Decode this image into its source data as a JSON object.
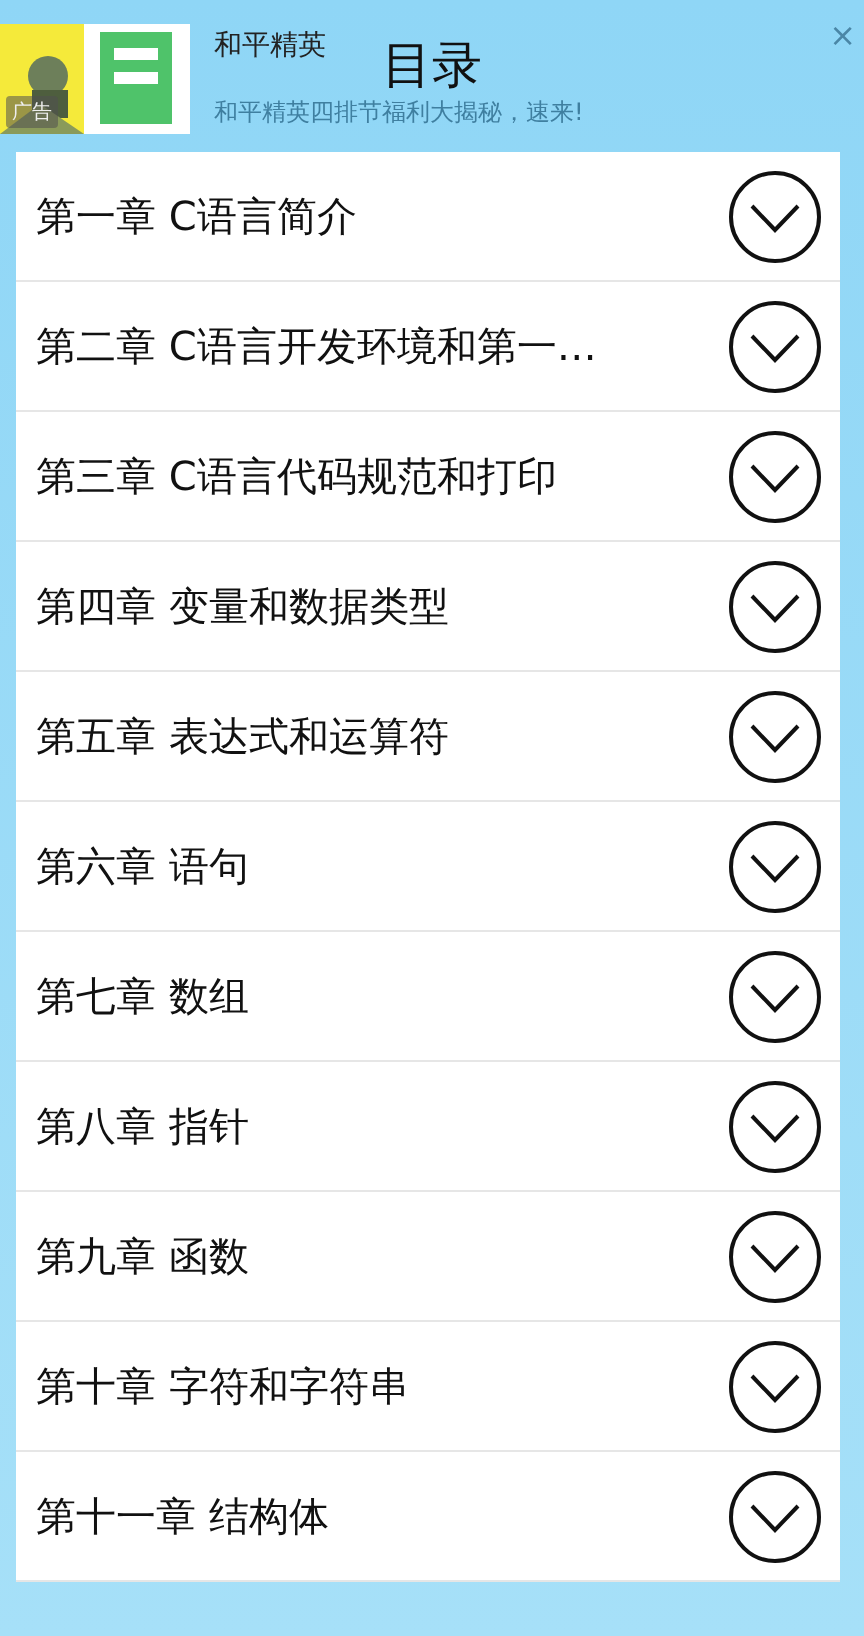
{
  "ad": {
    "kind": "picture",
    "tag": "广告",
    "title": "和平精英",
    "subtitle": "和平精英四排节福利大揭秘，速来!",
    "close": "×"
  },
  "title": "目录",
  "chapters": [
    {
      "label": "第一章 C语言简介"
    },
    {
      "label": "第二章 C语言开发环境和第一…"
    },
    {
      "label": "第三章 C语言代码规范和打印"
    },
    {
      "label": "第四章 变量和数据类型"
    },
    {
      "label": "第五章 表达式和运算符"
    },
    {
      "label": "第六章 语句"
    },
    {
      "label": "第七章 数组"
    },
    {
      "label": "第八章 指针"
    },
    {
      "label": "第九章 函数"
    },
    {
      "label": "第十章 字符和字符串"
    },
    {
      "label": "第十一章 结构体"
    }
  ]
}
